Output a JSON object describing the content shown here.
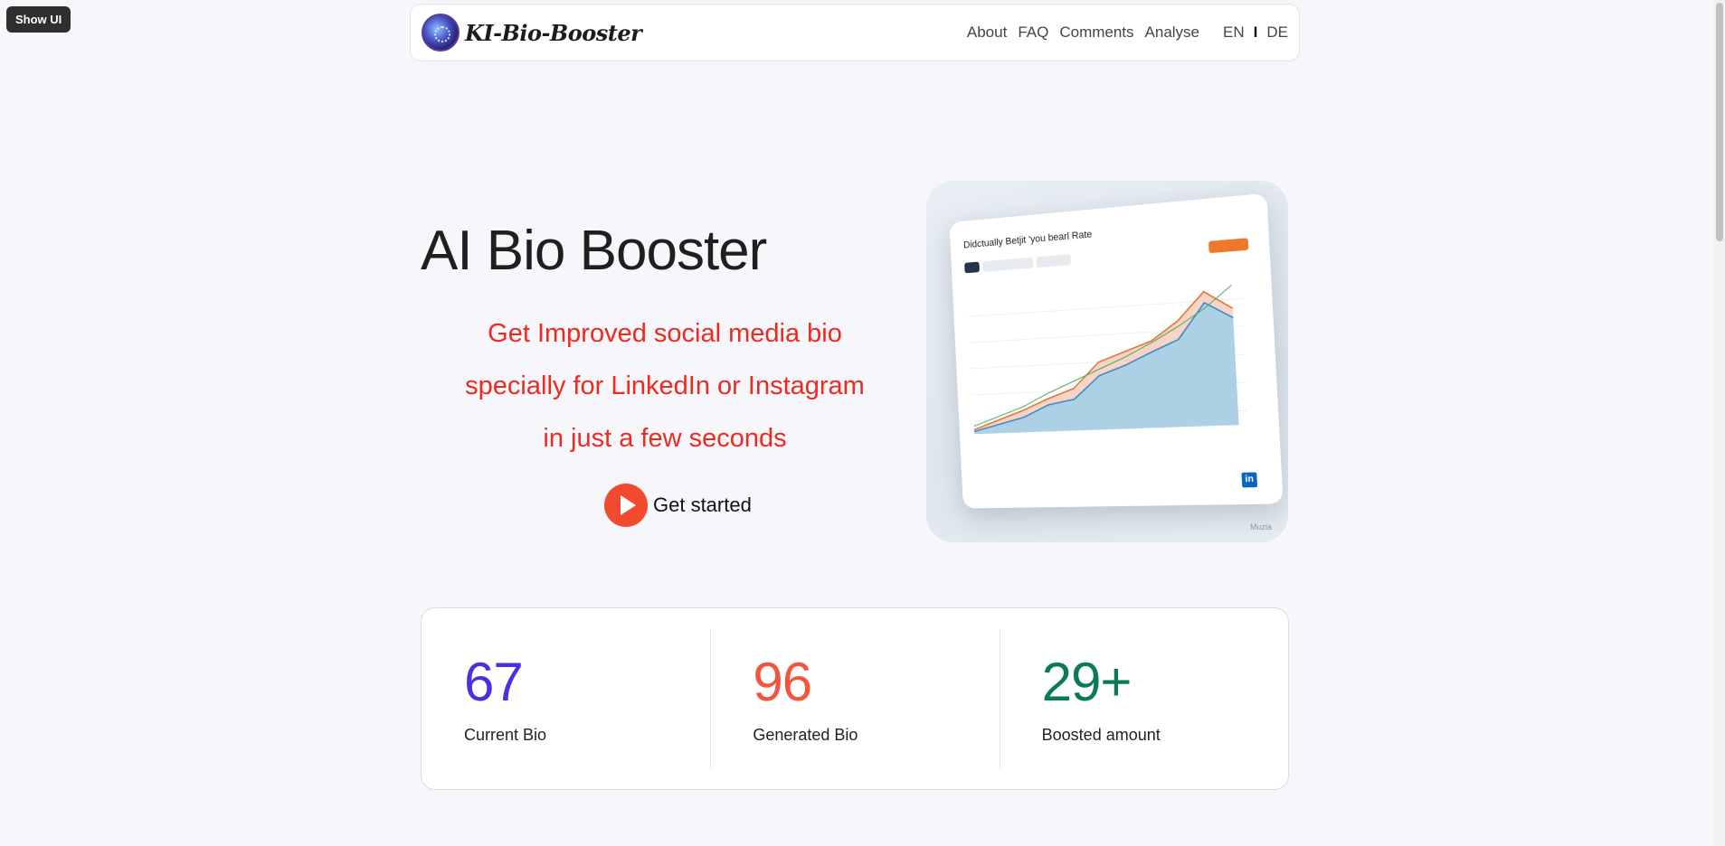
{
  "overlay": {
    "show_ui_label": "Show UI"
  },
  "nav": {
    "brand": "KI-Bio-Booster",
    "links": [
      "About",
      "FAQ",
      "Comments",
      "Analyse"
    ],
    "lang_en": "EN",
    "lang_sep": "I",
    "lang_de": "DE"
  },
  "hero": {
    "title": "AI Bio Booster",
    "subtitle_lines": [
      "Get Improved social media bio",
      "specially for LinkedIn or Instagram",
      "in just a few seconds"
    ],
    "cta_label": "Get started",
    "image_text": {
      "heading": "Didctually Betjit 'you bearl Rate",
      "badge": "in",
      "mark": "Muzia"
    }
  },
  "stats": [
    {
      "value": "67",
      "label": "Current Bio",
      "color": "#4b2fe0"
    },
    {
      "value": "96",
      "label": "Generated Bio",
      "color": "#f2553e"
    },
    {
      "value": "29+",
      "label": "Boosted amount",
      "color": "#0b7a55"
    }
  ]
}
